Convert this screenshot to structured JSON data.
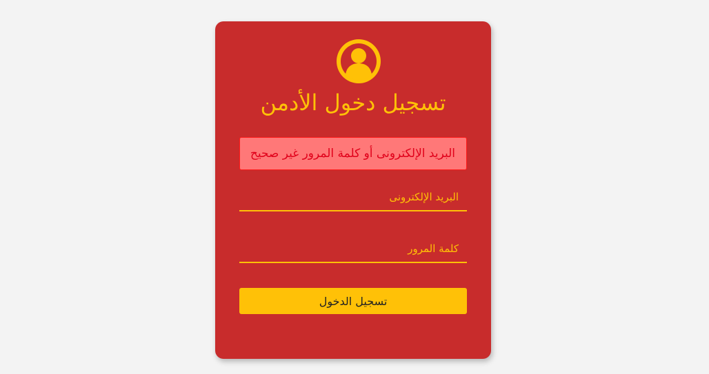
{
  "login": {
    "title": "تسجيل دخول الأدمن",
    "error_message": "البريد الإلكترونى أو كلمة المرور غير صحيح",
    "email_placeholder": "البريد الإلكترونى",
    "password_placeholder": "كلمة المرور",
    "submit_label": "تسجيل الدخول",
    "avatar_icon": "user-circle-icon"
  },
  "colors": {
    "page_background": "#f3f3f3",
    "card_background": "#c82c2c",
    "accent": "#ffc107",
    "error_background": "#ff7878",
    "error_text": "#e0001a",
    "button_text": "#222222"
  }
}
